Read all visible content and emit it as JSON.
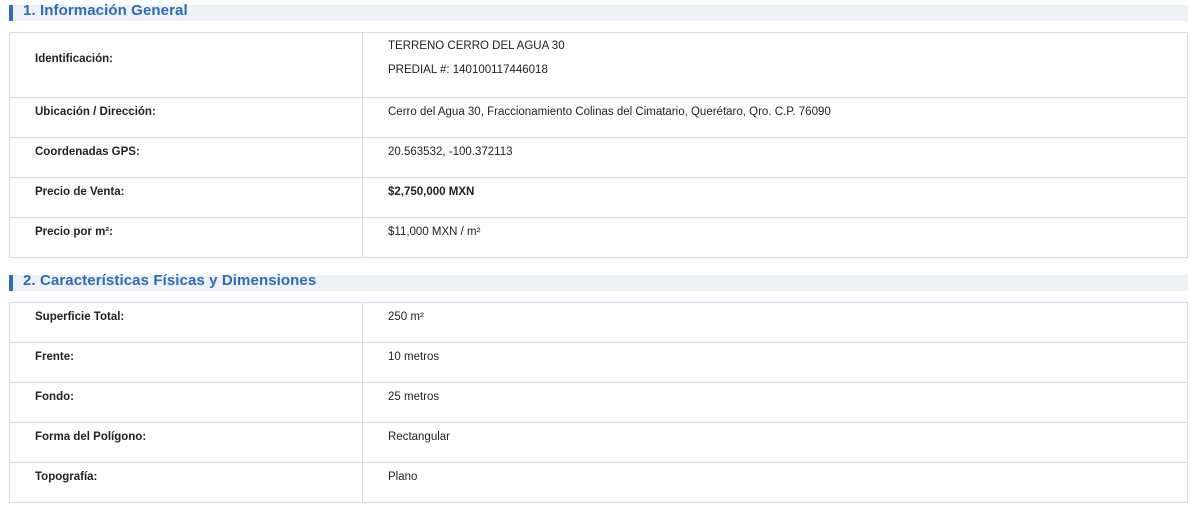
{
  "section1": {
    "title": "1. Información General",
    "rows": [
      {
        "label": "Identificación:",
        "value_lines": [
          "TERRENO CERRO DEL AGUA 30",
          "PREDIAL #: 140100117446018"
        ]
      },
      {
        "label": "Ubicación / Dirección:",
        "value": "Cerro del Agua 30, Fraccionamiento Colinas del Cimatario, Querétaro, Qro. C.P. 76090"
      },
      {
        "label": "Coordenadas GPS:",
        "value": "20.563532, -100.372113"
      },
      {
        "label": "Precio de Venta:",
        "value": "$2,750,000 MXN"
      },
      {
        "label": "Precio por m²:",
        "value": "$11,000 MXN / m²"
      }
    ]
  },
  "section2": {
    "title": "2. Características Físicas y Dimensiones",
    "rows": [
      {
        "label": "Superficie Total:",
        "value": "250 m²"
      },
      {
        "label": "Frente:",
        "value": "10 metros"
      },
      {
        "label": "Fondo:",
        "value": "25 metros"
      },
      {
        "label": "Forma del Polígono:",
        "value": "Rectangular"
      },
      {
        "label": "Topografía:",
        "value": "Plano"
      }
    ]
  },
  "colors": {
    "accent": "#2c6bb5",
    "header_bg": "#eef2f8",
    "border": "#d8dce2"
  }
}
